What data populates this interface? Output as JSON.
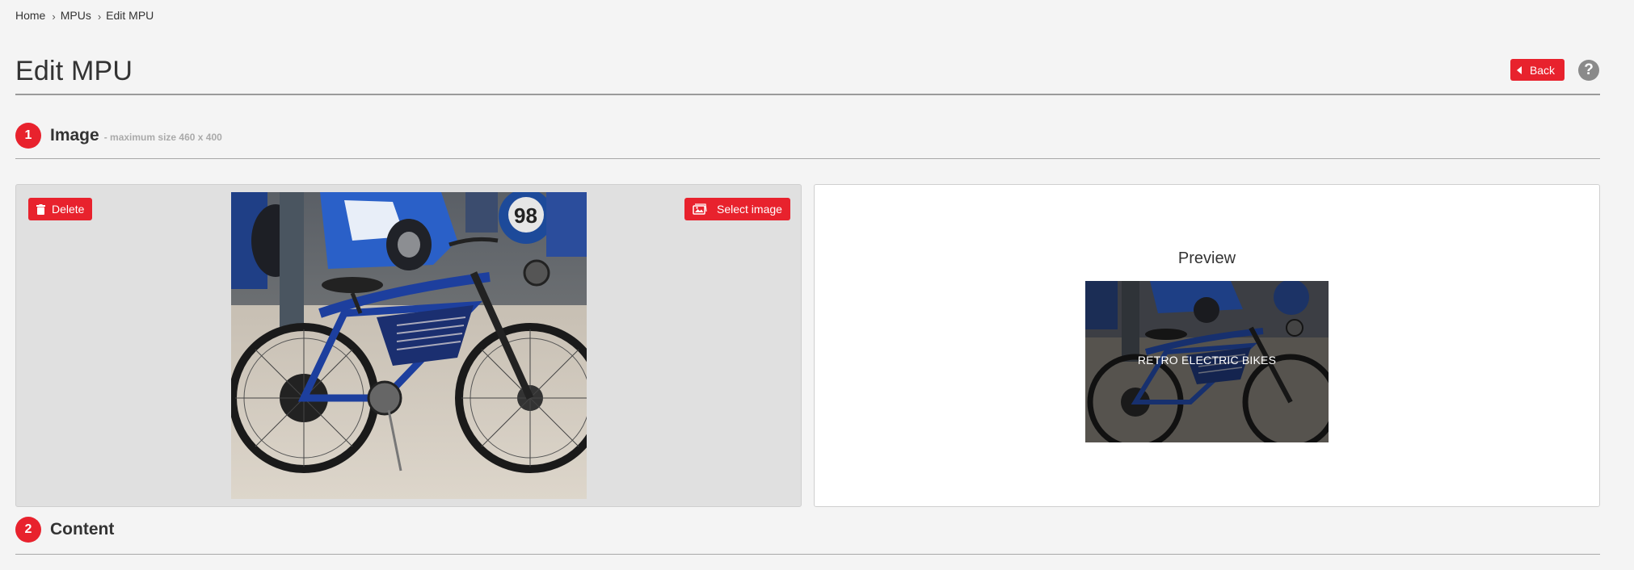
{
  "breadcrumb": [
    {
      "label": "Home"
    },
    {
      "label": "MPUs"
    },
    {
      "label": "Edit MPU"
    }
  ],
  "breadcrumb_separator": "›",
  "page": {
    "title": "Edit MPU",
    "back_label": "Back",
    "help_label": "?"
  },
  "sections": {
    "image": {
      "number": "1",
      "title": "Image",
      "subtitle": "- maximum size 460 x 400",
      "delete_label": "Delete",
      "select_label": "Select image",
      "preview_title": "Preview",
      "preview_overlay_text": "RETRO ELECTRIC BIKES"
    },
    "content": {
      "number": "2",
      "title": "Content"
    }
  },
  "colors": {
    "accent": "#e8222d",
    "background": "#f4f4f4",
    "help": "#8a8a8a"
  },
  "icons": {
    "back": "triangle-left-icon",
    "help": "question-icon",
    "delete": "trash-icon",
    "select": "image-icon"
  }
}
